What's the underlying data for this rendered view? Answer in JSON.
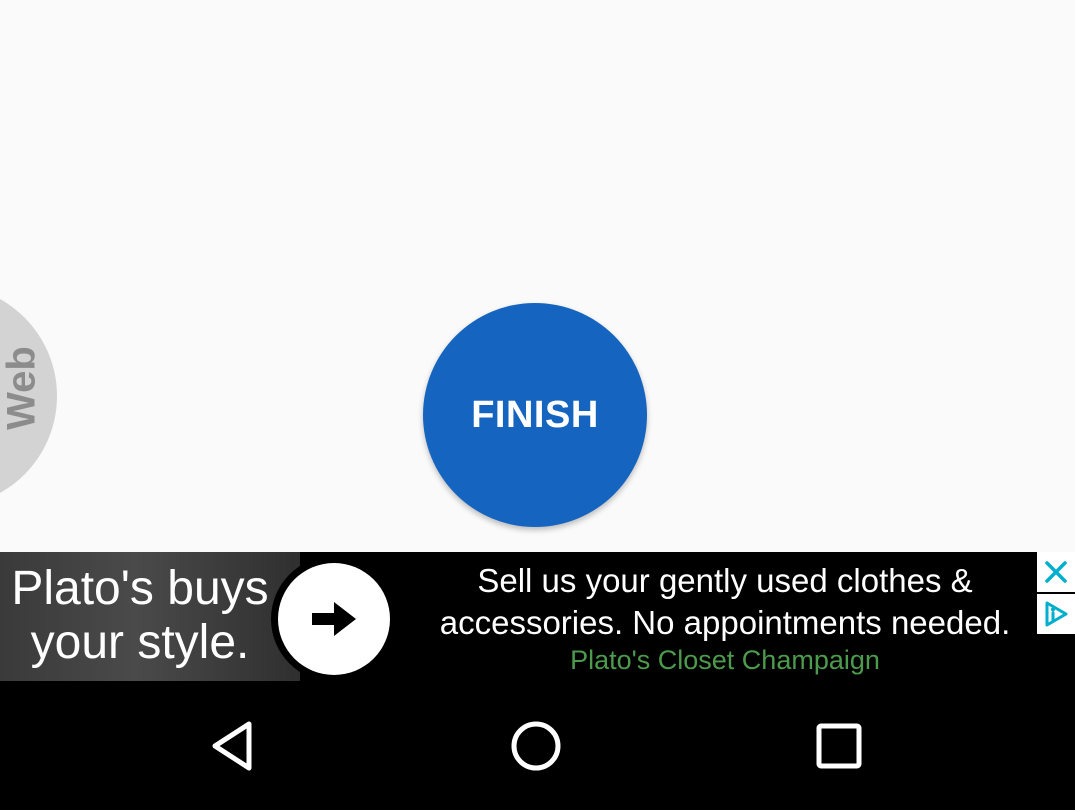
{
  "side_tab": {
    "label": "Web"
  },
  "main": {
    "finish_label": "FINISH"
  },
  "ad": {
    "headline_line1": "Plato's buys",
    "headline_line2": "your style.",
    "body_line1": "Sell us your gently used clothes &",
    "body_line2": "accessories. No appointments needed.",
    "advertiser": "Plato's Closet Champaign",
    "arrow_icon": "arrow-right-icon",
    "close_icon": "close-icon",
    "adchoices_icon": "adchoices-icon"
  },
  "nav": {
    "back_icon": "back-triangle-icon",
    "home_icon": "home-circle-icon",
    "recents_icon": "recents-square-icon"
  },
  "colors": {
    "finish_button": "#1565c0",
    "background": "#fafafa",
    "side_tab": "#d3d3d3",
    "advertiser_text": "#4c9a4c",
    "adchoices": "#00aecd"
  }
}
